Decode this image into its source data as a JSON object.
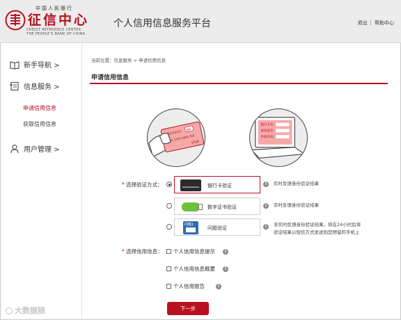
{
  "header": {
    "logo_top": "中国人民银行",
    "logo_main": "征信中心",
    "logo_en_line1": "CREDIT REFERENCE CENTER",
    "logo_en_line2": "THE PEOPLE'S BANK OF CHINA",
    "platform_title": "个人信用信息服务平台",
    "logout": "退出",
    "help": "帮助中心",
    "separator": "|"
  },
  "sidebar": {
    "guide": "新手导航 >",
    "info_service": "信息服务 >",
    "apply_info": "申请信用信息",
    "get_info": "获取信用信息",
    "user_mgmt": "用户管理 >"
  },
  "main": {
    "breadcrumb": "当前位置：信息服务 > 申请信用信息",
    "section_title": "申请信用信息",
    "card_number_text": "XXXXXXX",
    "card_digits": "4392 2500 8888 888",
    "card_brand": "VISA",
    "card_chip": "智能",
    "form_bank_no": "银行卡号：",
    "form_id_no": "身份证号：",
    "form_phone": "手机号码：",
    "verify_label_req": "*",
    "verify_label": " 选择验证方式：",
    "options": [
      {
        "label": "银行卡验证",
        "hint": "实时反馈身份验证结果",
        "checked": true
      },
      {
        "label": "数字证书验证",
        "hint": "实时反馈身份验证结果",
        "checked": false
      },
      {
        "label": "问题验证",
        "hint_line1": "非实时反馈身份验证结果，将在24小时后将",
        "hint_line2": "验证结果以短信方式发送到您预留的手机上",
        "checked": false
      }
    ],
    "question_icon_text": "问题1",
    "info_glyph": "i",
    "select_label_req": "*",
    "select_label": " 选择信用信息：",
    "checkboxes": [
      {
        "label": "个人信用信息提示"
      },
      {
        "label": "个人信用信息概要"
      },
      {
        "label": "个人信用报告"
      }
    ],
    "next_button": "下一步"
  },
  "watermark": "大数据狼",
  "colors": {
    "brand_red": "#b8101f",
    "header_bg": "#ececec"
  }
}
